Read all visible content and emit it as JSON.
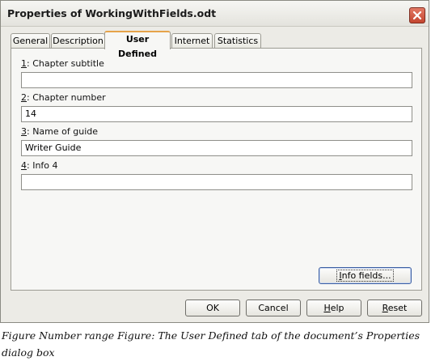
{
  "window": {
    "title": "Properties of WorkingWithFields.odt"
  },
  "tabs": [
    {
      "label": "General",
      "active": false
    },
    {
      "label": "Description",
      "active": false
    },
    {
      "label": "User Defined",
      "active": true
    },
    {
      "label": "Internet",
      "active": false
    },
    {
      "label": "Statistics",
      "active": false
    }
  ],
  "fields": [
    {
      "mnemonic": "1",
      "label": ": Chapter subtitle",
      "value": ""
    },
    {
      "mnemonic": "2",
      "label": ": Chapter number",
      "value": "14"
    },
    {
      "mnemonic": "3",
      "label": ": Name of guide",
      "value": "Writer Guide"
    },
    {
      "mnemonic": "4",
      "label": ": Info 4",
      "value": ""
    }
  ],
  "info_fields_button": {
    "mnemonic": "I",
    "rest": "nfo fields..."
  },
  "buttons": {
    "ok": "OK",
    "cancel": "Cancel",
    "help": {
      "mnemonic": "H",
      "rest": "elp"
    },
    "reset": {
      "mnemonic": "R",
      "rest": "eset"
    }
  },
  "caption": "Figure Number range Figure: The User Defined tab of the document’s Properties dialog box",
  "colors": {
    "active_tab_accent": "#e6a34a",
    "close_button": "#c4452f",
    "dialog_background": "#ecebe6"
  }
}
